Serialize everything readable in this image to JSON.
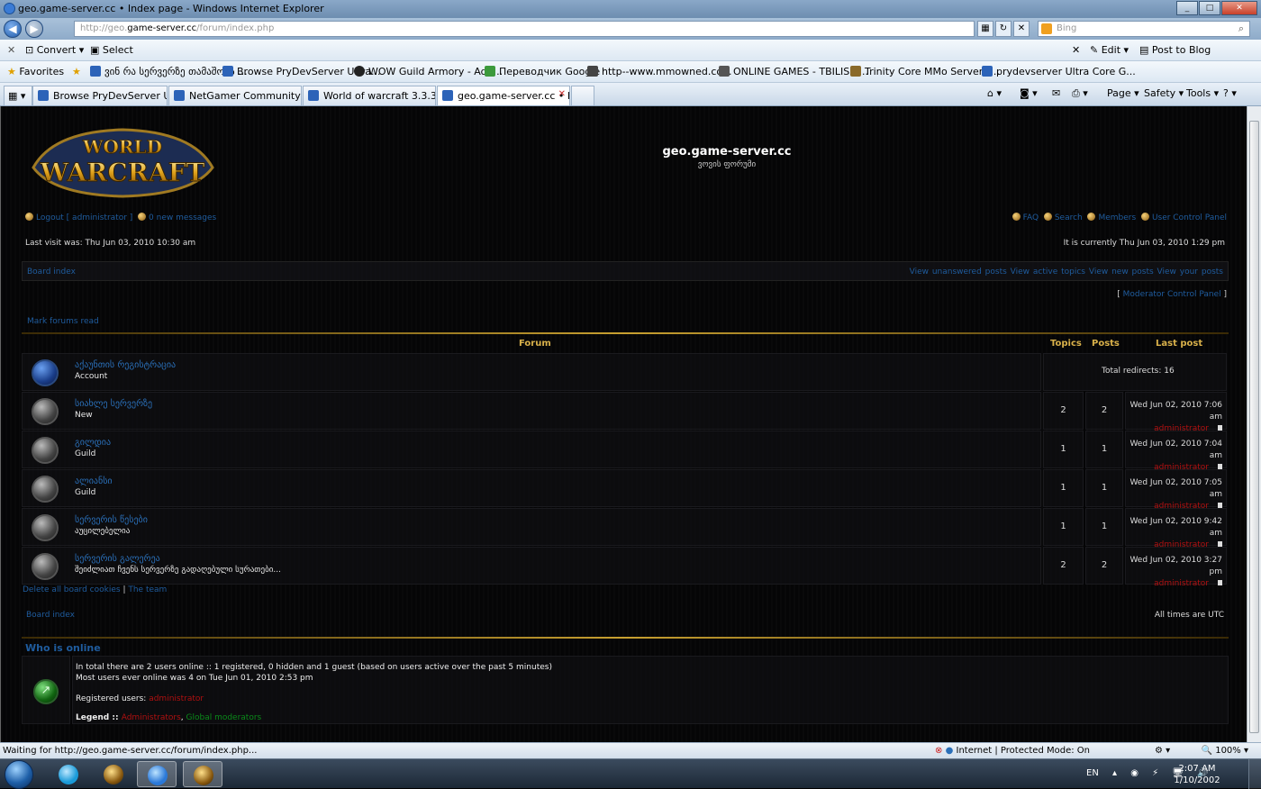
{
  "window": {
    "title": "geo.game-server.cc • Index page - Windows Internet Explorer",
    "controls": [
      "_",
      "□",
      "✕"
    ]
  },
  "address": {
    "url_prefix": "http://geo.",
    "url_host": "game-server.cc",
    "url_path": "/forum/index.php",
    "search_placeholder": "Bing"
  },
  "toolbar": {
    "convert": "Convert",
    "select": "Select",
    "edit": "Edit",
    "post_to_blog": "Post to Blog"
  },
  "favorites": {
    "label": "Favorites",
    "items": [
      "ვინ რა სერვერზე თამაშობს ...",
      "Browse PryDevServer Ultra...",
      "WOW Guild Armory - Add...",
      "Переводчик Google",
      "http--www.mmowned.co...",
      "ONLINE GAMES - TBILISIS...",
      "Trinity Core MMo Server F...",
      "prydevserver Ultra Core  G..."
    ]
  },
  "tabs": [
    "Browse PryDevServer Ultra...",
    "NetGamer Community -> ...",
    "World of warcraft 3.3.3 -> ...",
    "geo.game-server.cc • I..."
  ],
  "commands": {
    "page": "Page",
    "safety": "Safety",
    "tools": "Tools",
    "help": "?"
  },
  "site": {
    "title": "geo.game-server.cc",
    "subtitle": "ვოვის ფორუმი",
    "logo_line1": "WORLD",
    "logo_line2": "WARCRAFT"
  },
  "userbar": {
    "logout": "Logout [ administrator ]",
    "messages": "0 new messages",
    "faq": "FAQ",
    "search": "Search",
    "members": "Members",
    "ucp": "User Control Panel"
  },
  "times": {
    "last_visit": "Last visit was: Thu Jun 03, 2010 10:30 am",
    "current": "It is currently Thu Jun 03, 2010 1:29 pm",
    "all_times": "All times are UTC"
  },
  "nav": {
    "board_index": "Board index",
    "links": [
      "View unanswered posts",
      "View active topics",
      "View new posts",
      "View your posts"
    ],
    "mcp": "Moderator Control Panel",
    "mark_read": "Mark forums read"
  },
  "forum_table": {
    "headers": {
      "forum": "Forum",
      "topics": "Topics",
      "posts": "Posts",
      "last_post": "Last post"
    },
    "rows": [
      {
        "name": "აქაუნთის რეგისტრაცია",
        "desc": "Account",
        "redirect": "Total redirects: 16",
        "icon": "blue-forum-icon"
      },
      {
        "name": "სიახლე სერვერზე",
        "desc": "New",
        "topics": "2",
        "posts": "2",
        "last_date": "Wed Jun 02, 2010 7:06 am",
        "last_user": "administrator"
      },
      {
        "name": "გილდია",
        "desc": "Guild",
        "topics": "1",
        "posts": "1",
        "last_date": "Wed Jun 02, 2010 7:04 am",
        "last_user": "administrator"
      },
      {
        "name": "ალიანსი",
        "desc": "Guild",
        "topics": "1",
        "posts": "1",
        "last_date": "Wed Jun 02, 2010 7:05 am",
        "last_user": "administrator"
      },
      {
        "name": "სერვერის წესები",
        "desc": "აუცილებელია",
        "topics": "1",
        "posts": "1",
        "last_date": "Wed Jun 02, 2010 9:42 am",
        "last_user": "administrator"
      },
      {
        "name": "სერვერის გალერეა",
        "desc": "შეიძლიათ ჩვენს სერვერზე გადაღებული სურათები...",
        "topics": "2",
        "posts": "2",
        "last_date": "Wed Jun 02, 2010 3:27 pm",
        "last_user": "administrator"
      }
    ]
  },
  "footer_links": {
    "delete_cookies": "Delete all board cookies",
    "separator": "|",
    "team": "The team"
  },
  "who_is_online": {
    "heading": "Who is online",
    "line1": "In total there are 2 users online :: 1 registered, 0 hidden and 1 guest (based on users active over the past 5 minutes)",
    "line2": "Most users ever online was 4 on Tue Jun 01, 2010 2:53 pm",
    "registered_label": "Registered users:",
    "registered_user": "administrator",
    "legend_label": "Legend ::",
    "legend_admin": "Administrators",
    "legend_mods": "Global moderators"
  },
  "statusbar": {
    "status": "Waiting for http://geo.game-server.cc/forum/index.php...",
    "zone": "Internet | Protected Mode: On",
    "zoom": "100%"
  },
  "taskbar": {
    "lang": "EN",
    "time": "2:07 AM",
    "date": "1/10/2002"
  },
  "colors": {
    "link": "#1f5c9e",
    "gold": "#d8b04a",
    "admin_red": "#b01010",
    "mod_green": "#0a8a1a"
  }
}
